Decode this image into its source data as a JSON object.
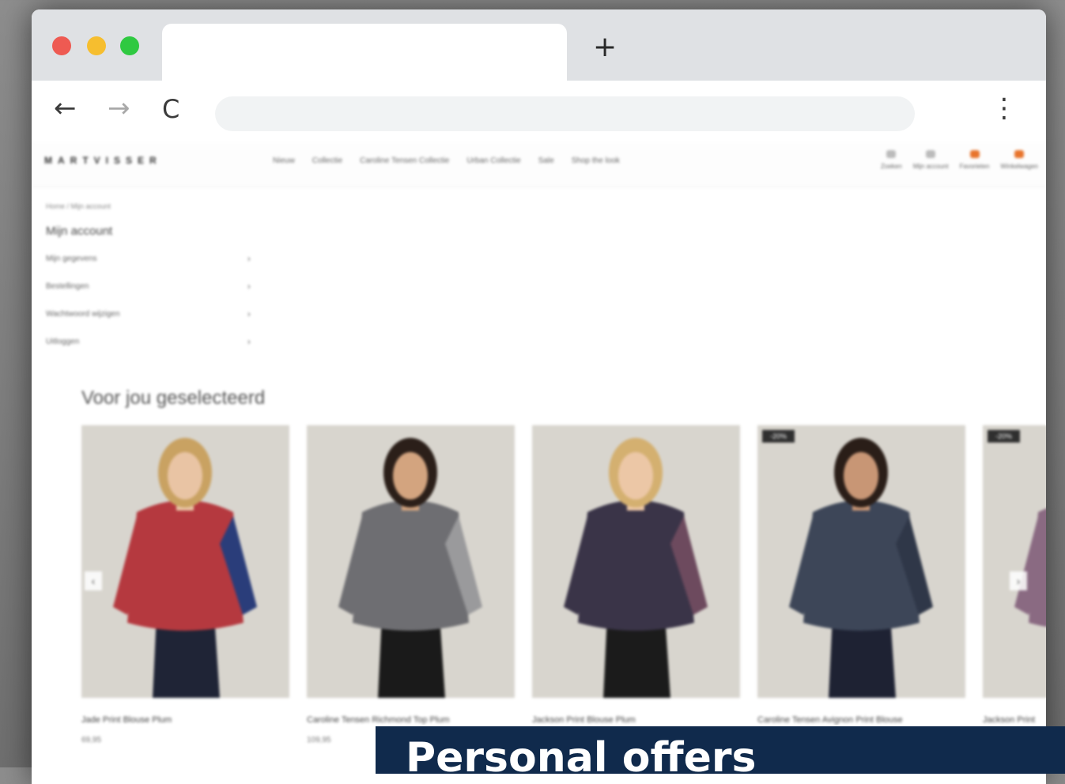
{
  "browser": {
    "new_tab_label": "+",
    "back_icon": "←",
    "forward_icon": "→",
    "reload_icon": "C",
    "menu_icon": "⋮"
  },
  "site": {
    "logo": "MARTVISSER",
    "nav": [
      "Nieuw",
      "Collectie",
      "Caroline Tensen Collectie",
      "Urban Collectie",
      "Sale",
      "Shop the look"
    ],
    "user_nav": [
      {
        "label": "Zoeken",
        "icon": "search-icon",
        "color": "#bbbbbb"
      },
      {
        "label": "Mijn account",
        "icon": "user-icon",
        "color": "#bbbbbb"
      },
      {
        "label": "Favorieten",
        "icon": "heart-icon",
        "color": "#e8742c"
      },
      {
        "label": "Winkelwagen",
        "icon": "cart-icon",
        "color": "#e8742c"
      }
    ],
    "breadcrumb": "Home / Mijn account",
    "account_title": "Mijn account",
    "account_menu": [
      {
        "label": "Mijn gegevens",
        "chevron": "›"
      },
      {
        "label": "Bestellingen",
        "chevron": "›"
      },
      {
        "label": "Wachtwoord wijzigen",
        "chevron": "›"
      },
      {
        "label": "Uitloggen",
        "chevron": "›"
      }
    ],
    "section_title": "Voor jou geselecteerd",
    "products": [
      {
        "name": "Jade Print Blouse Plum",
        "price": "69,95",
        "badge": "",
        "shirt": "#b5393f",
        "accent": "#2a3d7a",
        "skin": "#e9c4a4",
        "hair": "#c9a262",
        "pants": "#1f2436"
      },
      {
        "name": "Caroline Tensen Richmond Top Plum",
        "price": "109,95",
        "badge": "",
        "shirt": "#6e6e72",
        "accent": "#9a9a9c",
        "skin": "#d3a47f",
        "hair": "#2b1f19",
        "pants": "#1a1a1a"
      },
      {
        "name": "Jackson Print Blouse Plum",
        "price": "",
        "badge": "",
        "shirt": "#3a3448",
        "accent": "#6d4a5e",
        "skin": "#ecc7a6",
        "hair": "#d4b070",
        "pants": "#1b1b1b"
      },
      {
        "name": "Caroline Tensen Avignon Print Blouse",
        "price": "",
        "badge": "-20%",
        "shirt": "#3d4658",
        "accent": "#2f3748",
        "skin": "#c89675",
        "hair": "#2a1e18",
        "pants": "#1e2233"
      },
      {
        "name": "Jackson Print",
        "price": "",
        "badge": "-20%",
        "shirt": "#8a6a82",
        "accent": "#d9c9a5",
        "skin": "#e6c2a0",
        "hair": "#c9a262",
        "pants": "#d9c9a5"
      }
    ],
    "prev_arrow": "‹",
    "next_arrow": "›"
  },
  "banner": {
    "text": "Personal offers",
    "color": "#102a4c"
  }
}
